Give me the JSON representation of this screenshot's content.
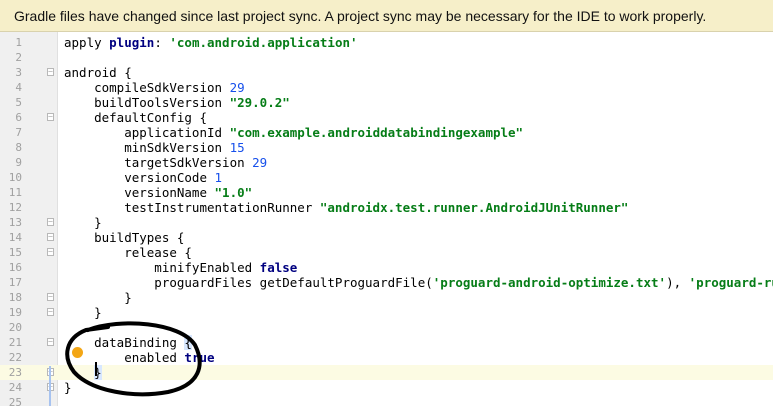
{
  "banner": {
    "message": "Gradle files have changed since last project sync. A project sync may be necessary for the IDE to work properly."
  },
  "editor": {
    "current_line": 23,
    "lines": [
      {
        "n": "1",
        "fold": false,
        "tokens": [
          {
            "t": "apply "
          },
          {
            "t": "plugin",
            "c": "k"
          },
          {
            "t": ": "
          },
          {
            "t": "'com.android.application'",
            "c": "s"
          }
        ]
      },
      {
        "n": "2",
        "fold": false,
        "tokens": []
      },
      {
        "n": "3",
        "fold": true,
        "tokens": [
          {
            "t": "android {"
          }
        ]
      },
      {
        "n": "4",
        "fold": false,
        "tokens": [
          {
            "t": "    compileSdkVersion "
          },
          {
            "t": "29",
            "c": "n"
          }
        ]
      },
      {
        "n": "5",
        "fold": false,
        "tokens": [
          {
            "t": "    buildToolsVersion "
          },
          {
            "t": "\"29.0.2\"",
            "c": "s"
          }
        ]
      },
      {
        "n": "6",
        "fold": true,
        "tokens": [
          {
            "t": "    defaultConfig {"
          }
        ]
      },
      {
        "n": "7",
        "fold": false,
        "tokens": [
          {
            "t": "        applicationId "
          },
          {
            "t": "\"com.example.androiddatabindingexample\"",
            "c": "s"
          }
        ]
      },
      {
        "n": "8",
        "fold": false,
        "tokens": [
          {
            "t": "        minSdkVersion "
          },
          {
            "t": "15",
            "c": "n"
          }
        ]
      },
      {
        "n": "9",
        "fold": false,
        "tokens": [
          {
            "t": "        targetSdkVersion "
          },
          {
            "t": "29",
            "c": "n"
          }
        ]
      },
      {
        "n": "10",
        "fold": false,
        "tokens": [
          {
            "t": "        versionCode "
          },
          {
            "t": "1",
            "c": "n"
          }
        ]
      },
      {
        "n": "11",
        "fold": false,
        "tokens": [
          {
            "t": "        versionName "
          },
          {
            "t": "\"1.0\"",
            "c": "s"
          }
        ]
      },
      {
        "n": "12",
        "fold": false,
        "tokens": [
          {
            "t": "        testInstrumentationRunner "
          },
          {
            "t": "\"androidx.test.runner.AndroidJUnitRunner\"",
            "c": "s"
          }
        ]
      },
      {
        "n": "13",
        "fold": true,
        "tokens": [
          {
            "t": "    }"
          }
        ]
      },
      {
        "n": "14",
        "fold": true,
        "tokens": [
          {
            "t": "    buildTypes {"
          }
        ]
      },
      {
        "n": "15",
        "fold": true,
        "tokens": [
          {
            "t": "        release {"
          }
        ]
      },
      {
        "n": "16",
        "fold": false,
        "tokens": [
          {
            "t": "            minifyEnabled "
          },
          {
            "t": "false",
            "c": "k"
          }
        ]
      },
      {
        "n": "17",
        "fold": false,
        "tokens": [
          {
            "t": "            proguardFiles getDefaultProguardFile("
          },
          {
            "t": "'proguard-android-optimize.txt'",
            "c": "s"
          },
          {
            "t": "), "
          },
          {
            "t": "'proguard-rules.pro'",
            "c": "s"
          }
        ]
      },
      {
        "n": "18",
        "fold": true,
        "tokens": [
          {
            "t": "        }"
          }
        ]
      },
      {
        "n": "19",
        "fold": true,
        "tokens": [
          {
            "t": "    }"
          }
        ]
      },
      {
        "n": "20",
        "fold": false,
        "tokens": []
      },
      {
        "n": "21",
        "fold": true,
        "tokens": [
          {
            "t": "    dataBinding "
          },
          {
            "t": "{",
            "c": "b"
          }
        ]
      },
      {
        "n": "22",
        "fold": false,
        "tokens": [
          {
            "t": "        enabled "
          },
          {
            "t": "true",
            "c": "k"
          }
        ]
      },
      {
        "n": "23",
        "fold": true,
        "tokens": [
          {
            "t": "    "
          },
          {
            "t": "}",
            "c": "b"
          }
        ]
      },
      {
        "n": "24",
        "fold": true,
        "tokens": [
          {
            "t": "}"
          }
        ]
      },
      {
        "n": "25",
        "fold": false,
        "tokens": []
      }
    ]
  },
  "colors": {
    "banner_bg": "#f6efc9",
    "keyword": "#000080",
    "string": "#067d17",
    "number": "#1750eb",
    "scribble": "#000000"
  },
  "icons": [
    "fold-marker-icon",
    "intention-bulb-icon"
  ]
}
